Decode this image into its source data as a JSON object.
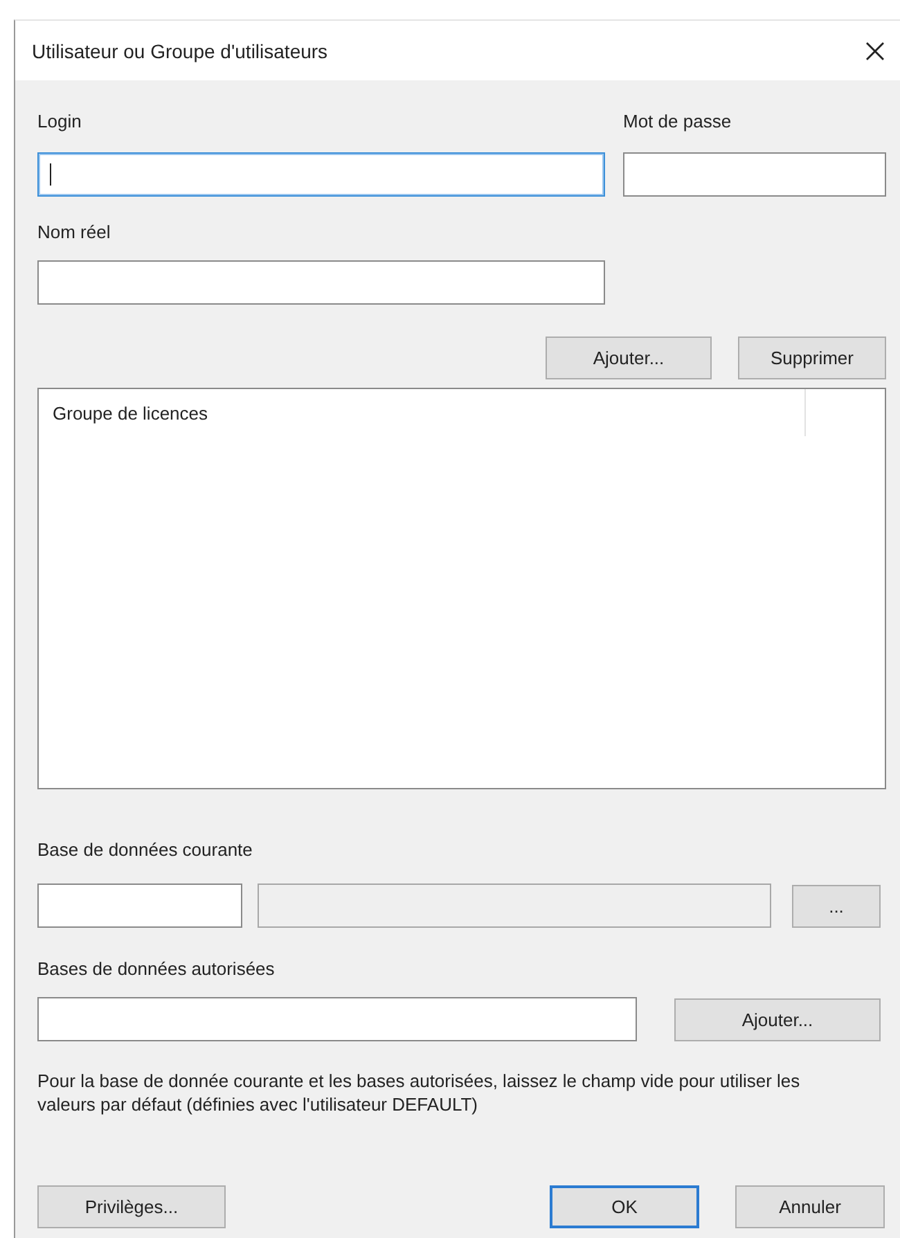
{
  "window": {
    "title": "Utilisateur ou Groupe d'utilisateurs"
  },
  "login": {
    "label": "Login",
    "focused": true
  },
  "password": {
    "label": "Mot de passe",
    "focused": false
  },
  "real_name": {
    "label": "Nom réel",
    "focused": false
  },
  "list_buttons": [
    {
      "label": "Ajouter..."
    },
    {
      "label": "Supprimer"
    }
  ],
  "list": {
    "columns": [
      {
        "label": "Groupe de licences"
      }
    ]
  },
  "current_database": {
    "label": "Base de données courante",
    "fields": [
      {
        "disabled": false
      },
      {
        "disabled": true
      }
    ],
    "button": "..."
  },
  "allowed_databases": {
    "label": "Bases de données autorisées",
    "button": "Ajouter..."
  },
  "note": "Pour la base de donnée courante et les bases autorisées, laissez le champ vide pour utiliser les valeurs par défaut (définies avec l'utilisateur DEFAULT)",
  "footer_buttons": [
    {
      "label": "Privilèges...",
      "default": false
    },
    {
      "label": "OK",
      "default": true
    },
    {
      "label": "Annuler",
      "default": false
    }
  ]
}
